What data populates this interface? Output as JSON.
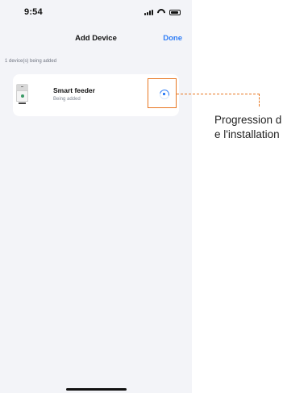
{
  "status_bar": {
    "time": "9:54"
  },
  "nav": {
    "title": "Add Device",
    "done_label": "Done"
  },
  "section_note": "1 device(s) being added",
  "device": {
    "name": "Smart feeder",
    "status": "Being added"
  },
  "annotation": {
    "text": "Progression de l'installation",
    "color": "#e87722"
  },
  "colors": {
    "accent": "#2f7df6",
    "background": "#f3f4f8"
  }
}
